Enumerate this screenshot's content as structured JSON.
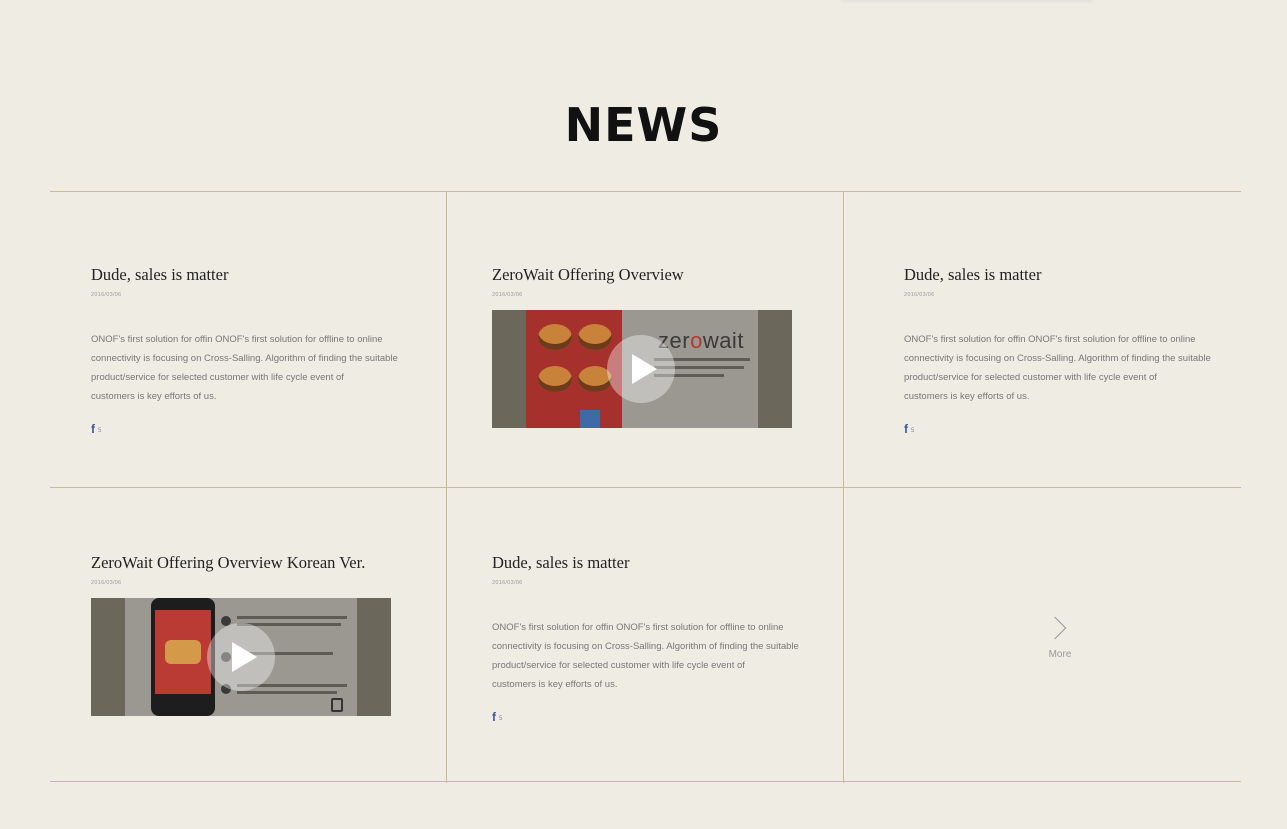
{
  "section": {
    "title": "NEWS"
  },
  "cards": [
    {
      "title": "Dude, sales is matter",
      "date": "2016/03/06",
      "body": [
        "ONOF's first solution for offin ONOF's first solution for offline to online",
        "connectivity is focusing on Cross-Salling. Algorithm of finding the suitable",
        "product/service for selected customer  with life cycle event of",
        "customers is key efforts of us."
      ],
      "fb_icon": "f",
      "fb_count": "5"
    },
    {
      "title": "ZeroWait Offering Overview",
      "date": "2016/03/06",
      "video_logo_a": "zer",
      "video_logo_o": "o",
      "video_logo_b": "wait",
      "play_icon": "play-icon"
    },
    {
      "title": "Dude, sales is matter",
      "date": "2016/03/06",
      "body": [
        "ONOF's first solution for offin ONOF's first solution for offline to online",
        "connectivity is focusing on Cross-Salling. Algorithm of finding the suitable",
        "product/service for selected customer  with life cycle event of",
        "customers is key efforts of us."
      ],
      "fb_icon": "f",
      "fb_count": "5"
    },
    {
      "title": "ZeroWait Offering Overview Korean Ver.",
      "date": "2016/03/06",
      "play_icon": "play-icon"
    },
    {
      "title": "Dude, sales is matter",
      "date": "2016/03/06",
      "body": [
        "ONOF's first solution for offin ONOF's first solution for offline to online",
        "connectivity is focusing on Cross-Salling. Algorithm of finding the suitable",
        "product/service for selected customer  with life cycle event of",
        "customers is key efforts of us."
      ],
      "fb_icon": "f",
      "fb_count": "5"
    }
  ],
  "more": {
    "label": "More",
    "icon": "chevron-right-icon"
  },
  "colors": {
    "background": "#efece4",
    "divider": "#cdb98d",
    "facebook": "#3b5998"
  }
}
